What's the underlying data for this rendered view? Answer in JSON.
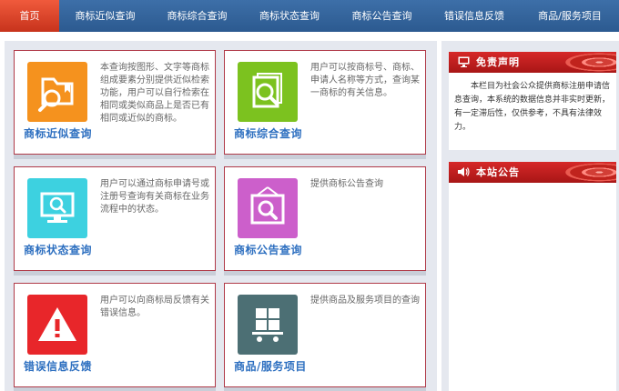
{
  "nav": {
    "items": [
      {
        "label": "首页",
        "active": true
      },
      {
        "label": "商标近似查询",
        "active": false
      },
      {
        "label": "商标综合查询",
        "active": false
      },
      {
        "label": "商标状态查询",
        "active": false
      },
      {
        "label": "商标公告查询",
        "active": false
      },
      {
        "label": "错误信息反馈",
        "active": false
      },
      {
        "label": "商品/服务项目",
        "active": false
      }
    ]
  },
  "cards": [
    {
      "title": "商标近似查询",
      "icon": "folder-search-icon",
      "color": "#f5921e",
      "desc": "本查询按图形、文字等商标组成要素分别提供近似检索功能，用户可以自行检索在相同或类似商品上是否已有相同或近似的商标。"
    },
    {
      "title": "商标综合查询",
      "icon": "document-search-icon",
      "color": "#7cc21f",
      "desc": "用户可以按商标号、商标、申请人名称等方式，查询某一商标的有关信息。"
    },
    {
      "title": "商标状态查询",
      "icon": "monitor-search-icon",
      "color": "#3dd1e0",
      "desc": "用户可以通过商标申请号或注册号查询有关商标在业务流程中的状态。"
    },
    {
      "title": "商标公告查询",
      "icon": "notice-search-icon",
      "color": "#cc5fcb",
      "desc": "提供商标公告查询"
    },
    {
      "title": "错误信息反馈",
      "icon": "warning-icon",
      "color": "#e8262a",
      "desc": "用户可以向商标局反馈有关错误信息。"
    },
    {
      "title": "商品/服务项目",
      "icon": "cart-icon",
      "color": "#4c6f74",
      "desc": "提供商品及服务项目的查询"
    }
  ],
  "sidebar": {
    "disclaimer": {
      "title": "免责声明",
      "icon": "monitor-icon",
      "text": "本栏目为社会公众提供商标注册申请信息查询，本系统的数据信息并非实时更新，有一定滞后性，仅供参考，不具有法律效力。"
    },
    "notice": {
      "title": "本站公告",
      "icon": "speaker-icon"
    }
  }
}
